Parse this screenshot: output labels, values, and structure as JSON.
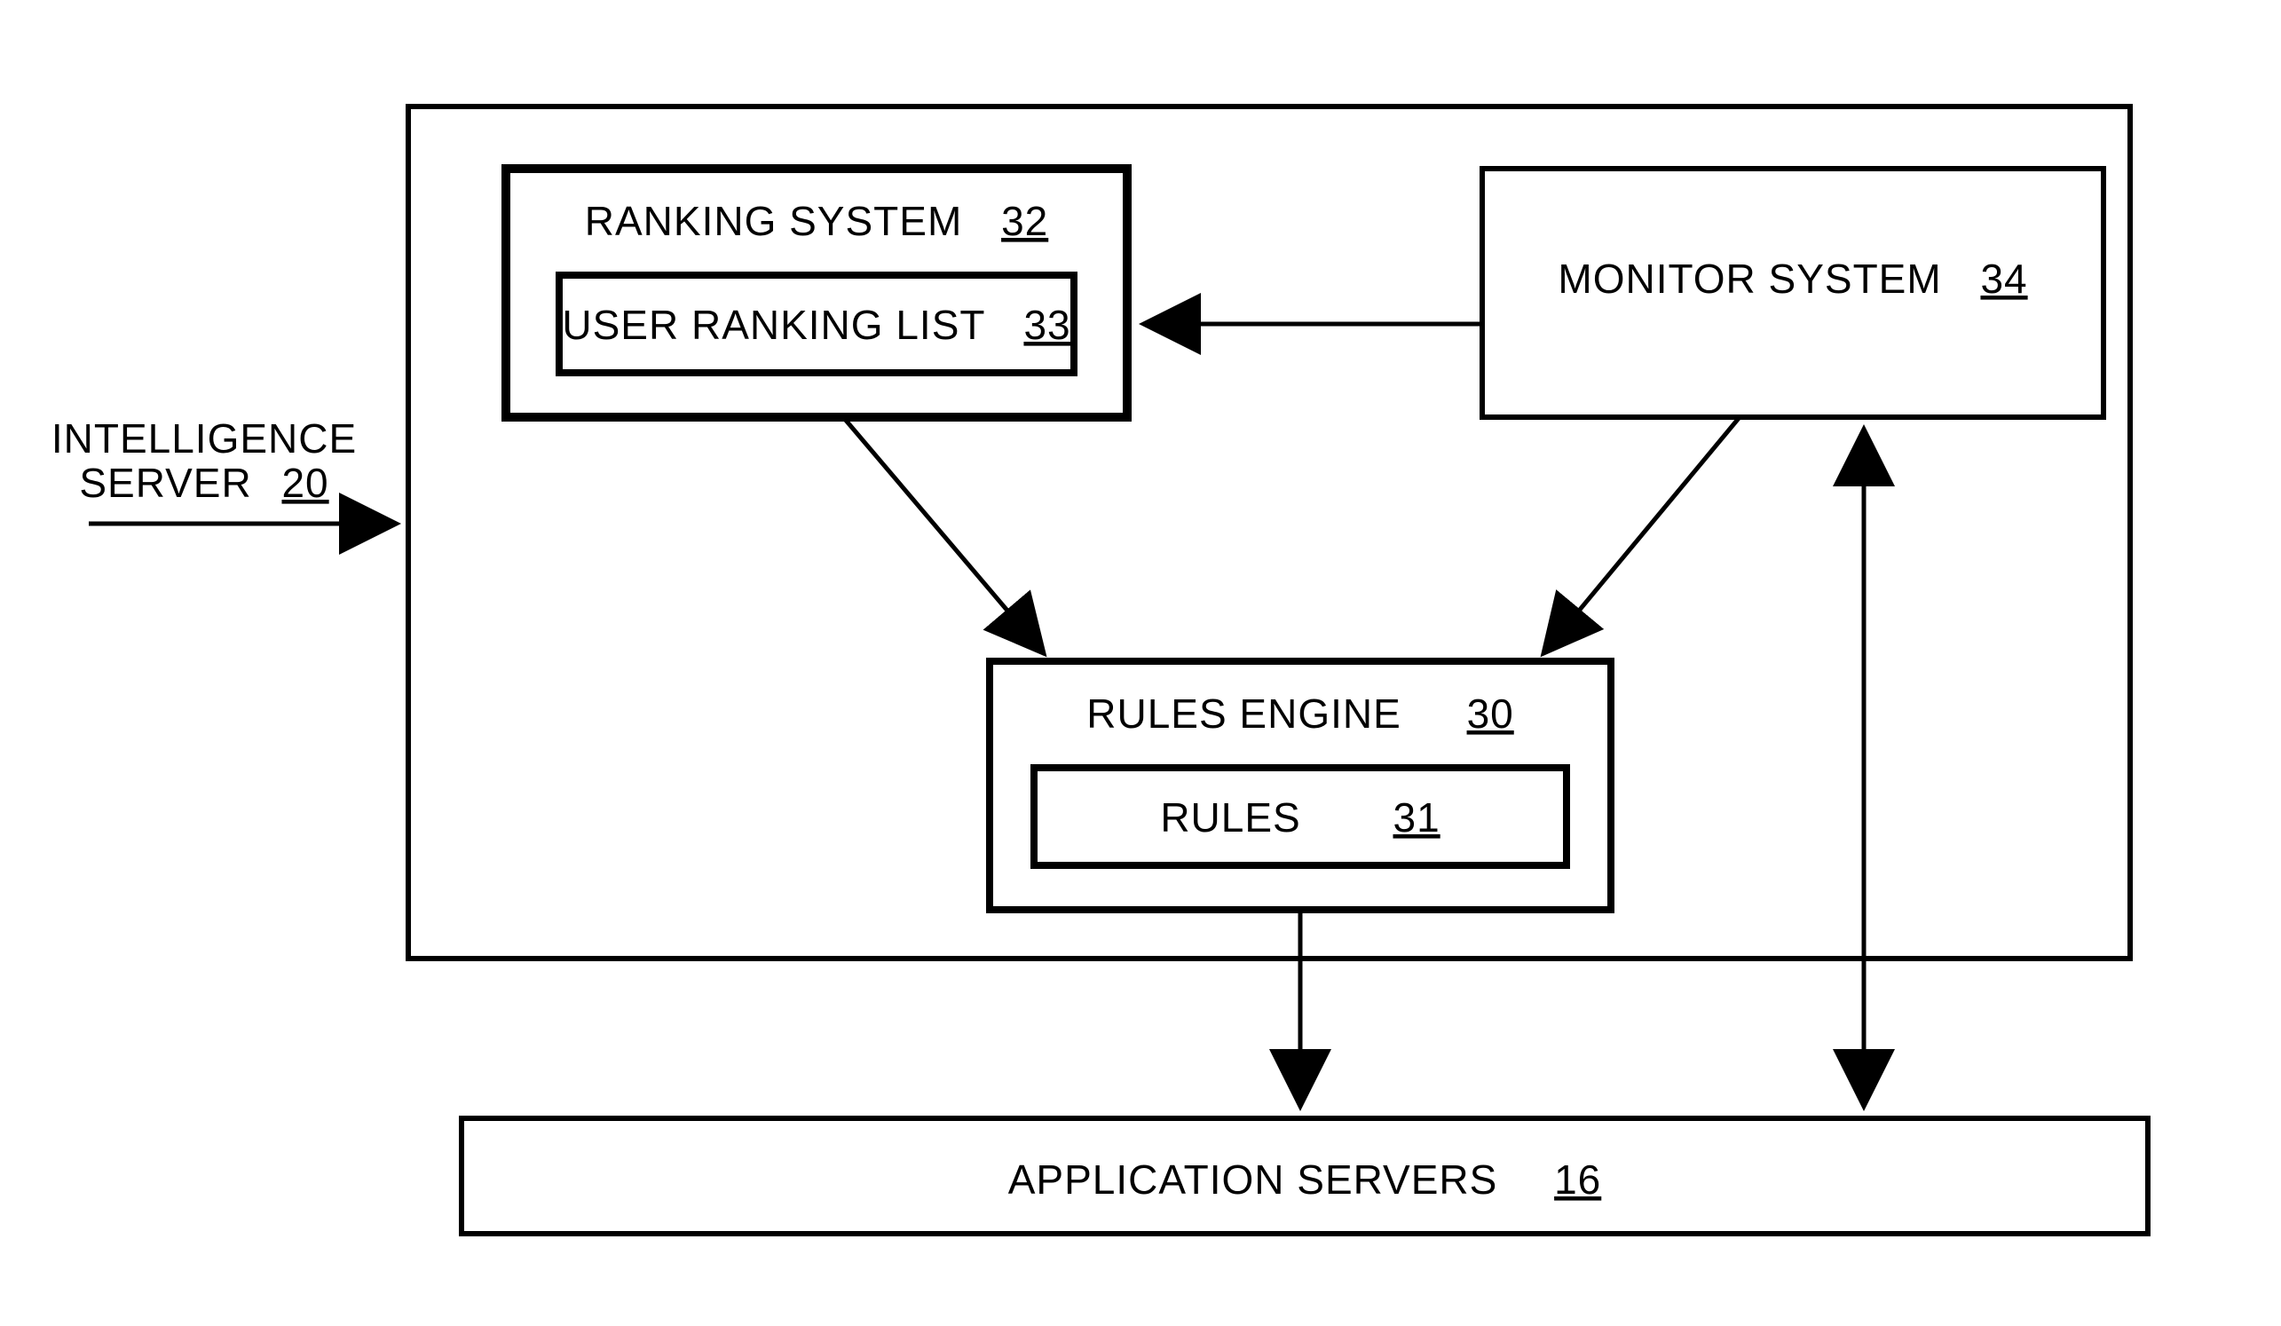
{
  "intelligence": {
    "label": "INTELLIGENCE",
    "sub": "SERVER",
    "num": "20"
  },
  "ranking": {
    "label": "RANKING SYSTEM",
    "num": "32"
  },
  "userlist": {
    "label": "USER RANKING LIST",
    "num": "33"
  },
  "monitor": {
    "label": "MONITOR SYSTEM",
    "num": "34"
  },
  "engine": {
    "label": "RULES ENGINE",
    "num": "30"
  },
  "rules": {
    "label": "RULES",
    "num": "31"
  },
  "appservers": {
    "label": "APPLICATION SERVERS",
    "num": "16"
  }
}
